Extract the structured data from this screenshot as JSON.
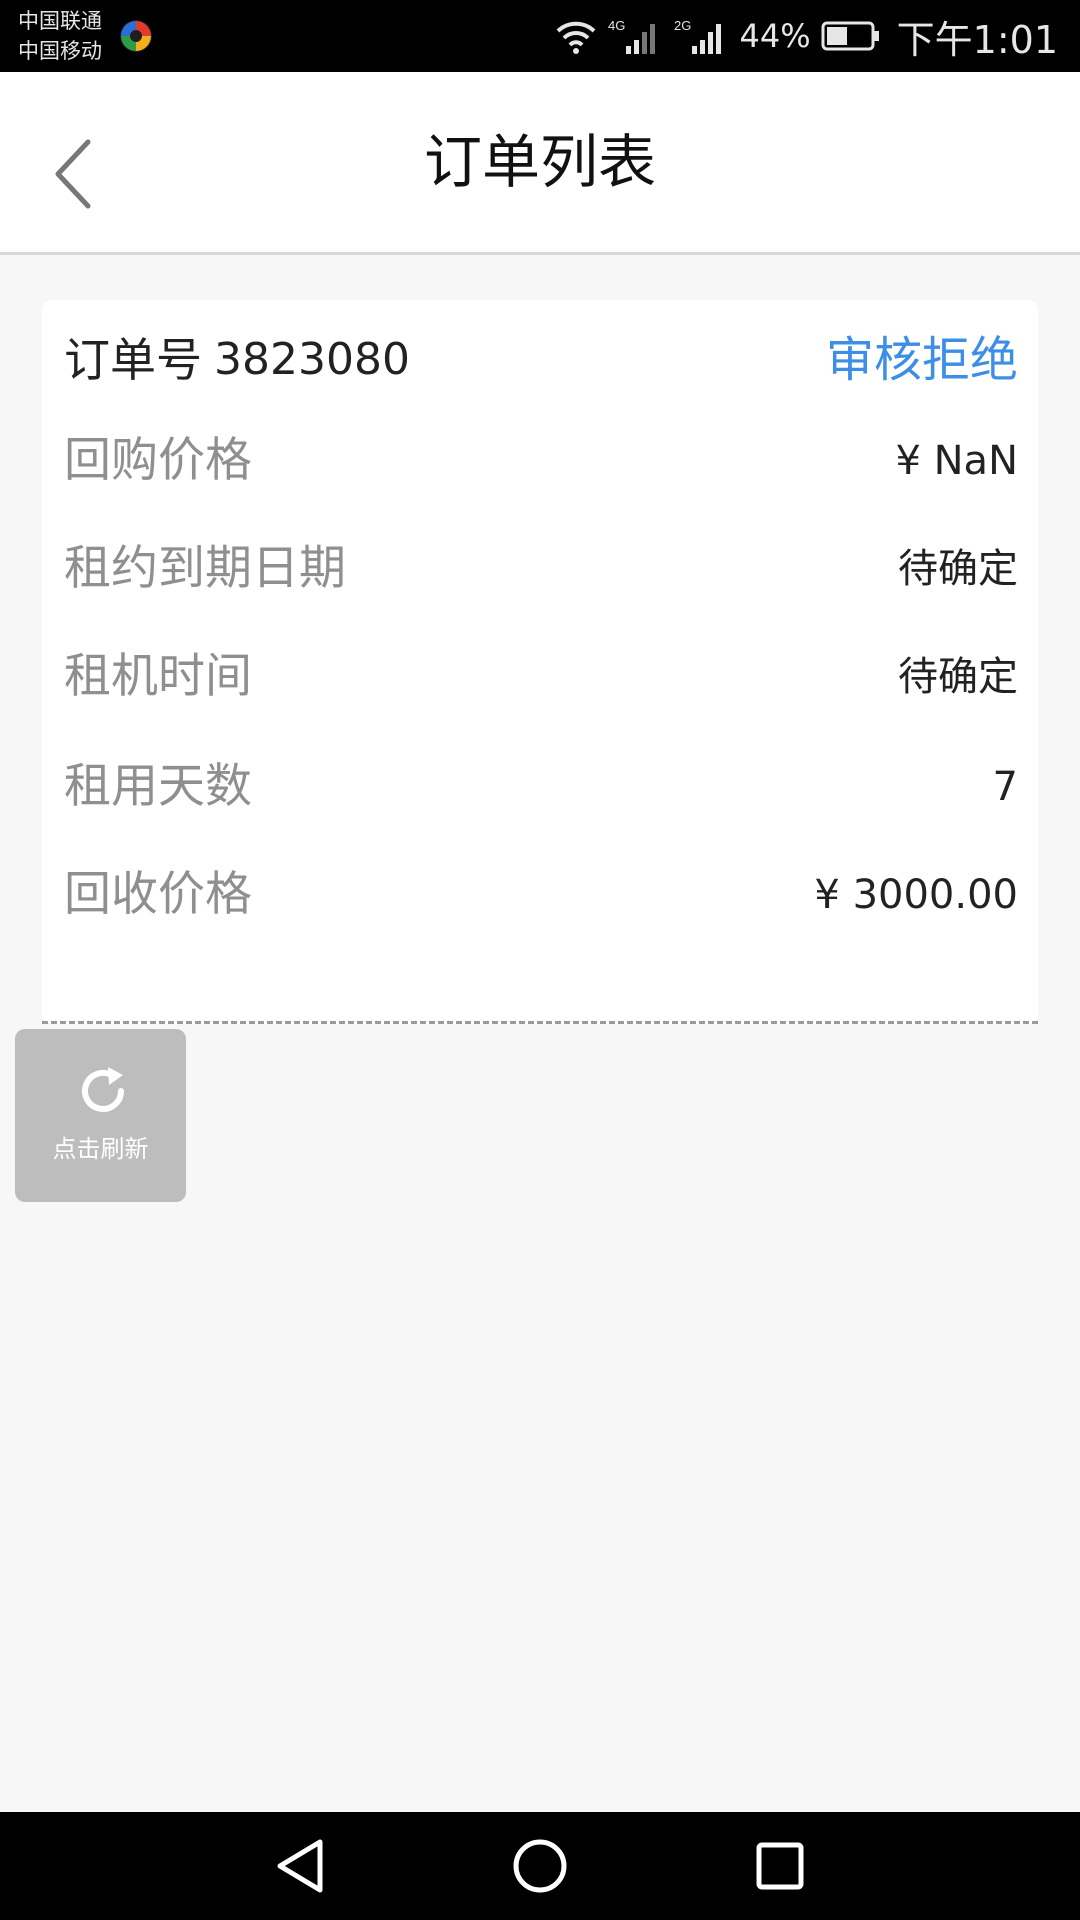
{
  "status_bar": {
    "carrier_1": "中国联通",
    "carrier_2": "中国移动",
    "network_1": "4G",
    "network_2": "2G",
    "battery_percent": "44%",
    "time": "下午1:01"
  },
  "header": {
    "title": "订单列表",
    "back_icon": "chevron-left-icon"
  },
  "order": {
    "order_no_label": "订单号",
    "order_no": "3823080",
    "status": "审核拒绝",
    "status_color": "#3d8ee6",
    "rows": [
      {
        "label": "回购价格",
        "value": "¥ NaN"
      },
      {
        "label": "租约到期日期",
        "value": "待确定"
      },
      {
        "label": "租机时间",
        "value": "待确定"
      },
      {
        "label": "租用天数",
        "value": "7"
      },
      {
        "label": "回收价格",
        "value": "¥ 3000.00"
      }
    ]
  },
  "refresh": {
    "label": "点击刷新",
    "icon": "refresh-icon"
  },
  "nav_bar": {
    "back_icon": "triangle-back-icon",
    "home_icon": "circle-home-icon",
    "recents_icon": "square-recents-icon"
  }
}
